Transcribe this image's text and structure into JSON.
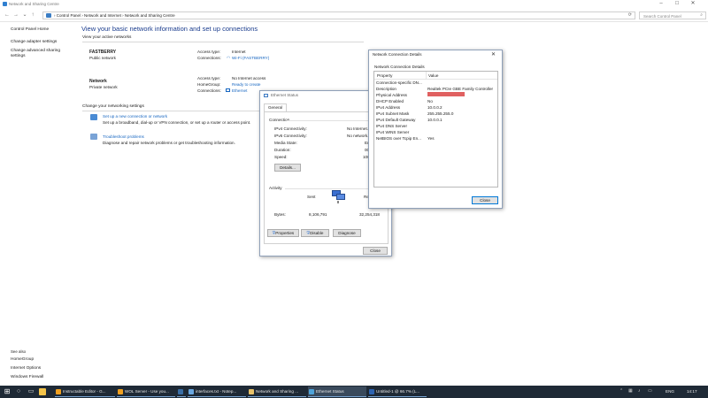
{
  "window": {
    "title": "Network and Sharing Centre",
    "address_crumbs": [
      "Control Panel",
      "Network and Internet",
      "Network and Sharing Centre"
    ],
    "search_placeholder": "Search Control Panel"
  },
  "left_pane": {
    "home": "Control Panel Home",
    "links": [
      "Change adapter settings",
      "Change advanced sharing",
      "settings"
    ],
    "see_also_label": "See also",
    "see_also": [
      "HomeGroup",
      "Internet Options",
      "Windows Firewall"
    ]
  },
  "main": {
    "title": "View your basic network information and set up connections",
    "active_header": "View your active networks",
    "networks": [
      {
        "name": "FASTBERRY",
        "type": "Public network",
        "access_label": "Access type:",
        "access_value": "Internet",
        "conn_label": "Connections:",
        "conn_value": "Wi-Fi (FASTBERRY)"
      },
      {
        "name": "Network",
        "type": "Private network",
        "access_label": "Access type:",
        "access_value": "No Internet access",
        "hg_label": "HomeGroup:",
        "hg_value": "Ready to create",
        "conn_label": "Connections:",
        "conn_value": "Ethernet"
      }
    ],
    "change_header": "Change your networking settings",
    "settings": [
      {
        "title": "Set up a new connection or network",
        "desc": "Set up a broadband, dial-up or VPN connection, or set up a router or access point."
      },
      {
        "title": "Troubleshoot problems",
        "desc": "Diagnose and repair network problems or get troubleshooting information."
      }
    ]
  },
  "ethernet_status": {
    "title": "Ethernet Status",
    "tab": "General",
    "connection_label": "Connection",
    "rows": [
      {
        "k": "IPv4 Connectivity:",
        "v": "No Internet..."
      },
      {
        "k": "IPv6 Connectivity:",
        "v": "No network..."
      },
      {
        "k": "Media State:",
        "v": "En..."
      },
      {
        "k": "Duration:",
        "v": "00..."
      },
      {
        "k": "Speed:",
        "v": "100..."
      }
    ],
    "details_btn": "Details...",
    "activity_label": "Activity",
    "sent_label": "Sent",
    "received_label": "Re",
    "bytes_label": "Bytes:",
    "bytes_sent": "8,106,791",
    "bytes_received": "32,254,318",
    "properties_btn": "Properties",
    "disable_btn": "Disable",
    "diagnose_btn": "Diagnose",
    "close_btn": "Close"
  },
  "details": {
    "title": "Network Connection Details",
    "group_label": "Network Connection Details",
    "col_property": "Property",
    "col_value": "Value",
    "rows": [
      {
        "k": "Connection-specific DN...",
        "v": ""
      },
      {
        "k": "Description",
        "v": "Realtek PCIe GBE Family Controller"
      },
      {
        "k": "Physical Address",
        "v": ""
      },
      {
        "k": "DHCP Enabled",
        "v": "No"
      },
      {
        "k": "IPv4 Address",
        "v": "10.0.0.2"
      },
      {
        "k": "IPv4 Subnet Mask",
        "v": "255.255.255.0"
      },
      {
        "k": "IPv4 Default Gateway",
        "v": "10.0.0.1"
      },
      {
        "k": "IPv4 DNS Server",
        "v": ""
      },
      {
        "k": "IPv4 WINS Server",
        "v": ""
      },
      {
        "k": "NetBIOS over Tcpip En...",
        "v": "Yes"
      }
    ],
    "redacted_color": "#e06060",
    "close_btn": "Close"
  },
  "taskbar": {
    "items": [
      {
        "label": "Instructable Editor - G...",
        "color": "#f0a020"
      },
      {
        "label": "WOL Server - Use you...",
        "color": "#f0a020"
      },
      {
        "label": "",
        "color": "#3a6ea5"
      },
      {
        "label": "interfaces.txt - Notep...",
        "color": "#6aa7e0"
      },
      {
        "label": "Network and Sharing ...",
        "color": "#e8c26a"
      },
      {
        "label": "Ethernet Status",
        "color": "#4fa3d9"
      },
      {
        "label": "Untitled-1 @ 66.7% (L...",
        "color": "#2d63b0"
      }
    ],
    "lang": "ENG",
    "time": "14:17"
  },
  "accent": "#1565c0"
}
